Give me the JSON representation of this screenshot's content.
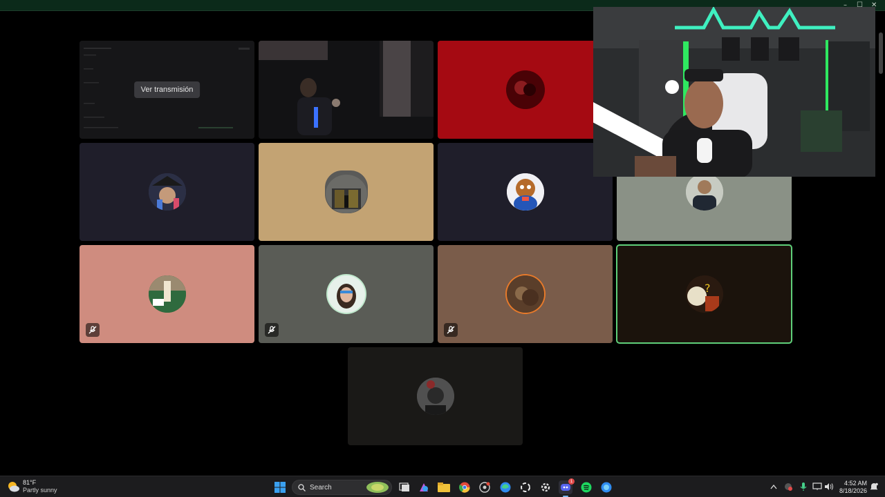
{
  "window": {
    "controls": {
      "minimize": "–",
      "maximize": "☐",
      "close": "✕"
    }
  },
  "call": {
    "stream_tile": {
      "button_label": "Ver transmisión"
    },
    "tiles": [
      {
        "id": "screen-share",
        "bg": "#1a1a1c"
      },
      {
        "id": "camera-user",
        "bg": "#141416"
      },
      {
        "id": "red-user",
        "bg": "#a50a12"
      },
      {
        "id": "user-dark-1",
        "bg": "#1f1e2a",
        "muted": false
      },
      {
        "id": "user-tan",
        "bg": "#c3a373",
        "muted": false
      },
      {
        "id": "user-chipmunk",
        "bg": "#1f1e2a",
        "muted": false
      },
      {
        "id": "user-sage",
        "bg": "#8a9186",
        "muted": false
      },
      {
        "id": "user-pink",
        "bg": "#cf8c7f",
        "muted": true
      },
      {
        "id": "user-grey",
        "bg": "#5a5c56",
        "muted": true
      },
      {
        "id": "user-brown",
        "bg": "#7a5c4a",
        "muted": true
      },
      {
        "id": "user-speaking",
        "bg": "#1b130c",
        "speaking": true
      },
      {
        "id": "user-bottom",
        "bg": "#1a1917"
      }
    ]
  },
  "colors": {
    "speaking_outline": "#5fd07a",
    "taskbar_bg": "#1c1c1e",
    "accent_blue": "#2f8cf0"
  },
  "taskbar": {
    "weather": {
      "temp": "81°F",
      "desc": "Partly sunny"
    },
    "search": {
      "placeholder": "Search"
    },
    "apps": [
      "windows-start-icon",
      "copilot-icon",
      "task-view-icon",
      "designer-icon",
      "file-explorer-icon",
      "chrome-icon",
      "steam-icon",
      "edge-icon",
      "app-icon",
      "settings-icon",
      "discord-icon",
      "spotify-icon",
      "browser-icon"
    ],
    "discord_badge": "1",
    "clock": {
      "time": "4:52 AM",
      "date": "8/18/2026"
    }
  }
}
